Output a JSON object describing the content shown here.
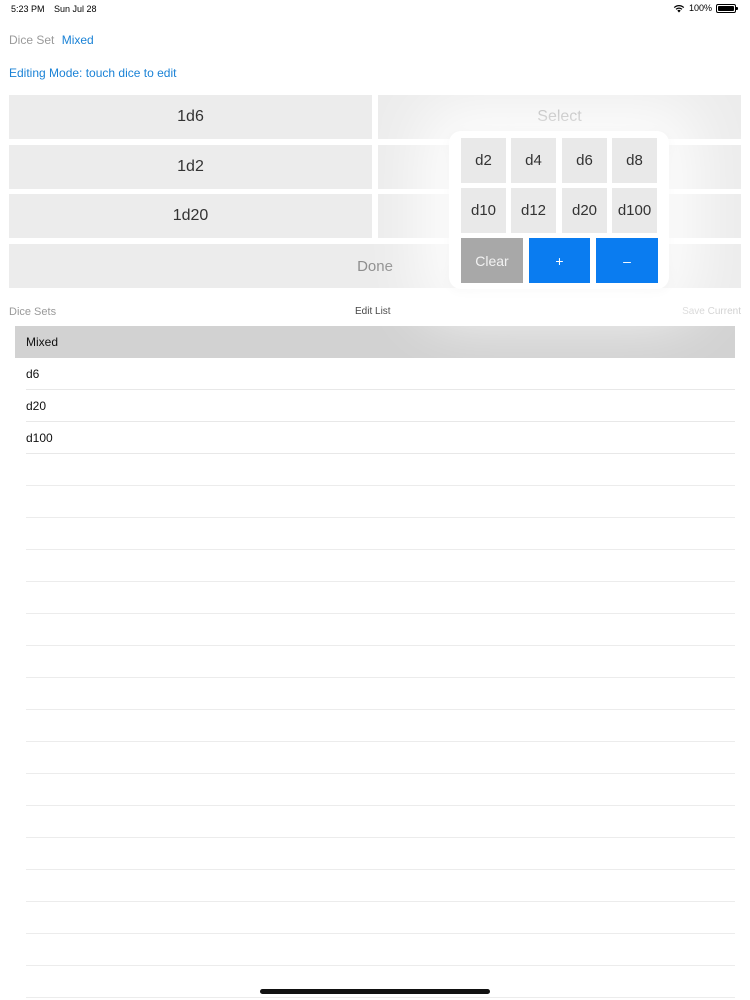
{
  "status_bar": {
    "time": "5:23 PM",
    "date": "Sun Jul 28",
    "battery": "100%"
  },
  "header": {
    "dice_set_label": "Dice Set",
    "dice_set_value": "Mixed",
    "editing_mode": "Editing Mode: touch dice to edit"
  },
  "dice_grid": {
    "left": [
      "1d6",
      "1d2",
      "1d20"
    ],
    "select": "Select",
    "done": "Done"
  },
  "list_header": {
    "dice_sets": "Dice Sets",
    "edit_list": "Edit List",
    "save_current": "Save Current"
  },
  "dice_sets": [
    {
      "label": "Mixed",
      "selected": true
    },
    {
      "label": "d6",
      "selected": false
    },
    {
      "label": "d20",
      "selected": false
    },
    {
      "label": "d100",
      "selected": false
    }
  ],
  "popover": {
    "dice_row1": [
      "d2",
      "d4",
      "d6",
      "d8"
    ],
    "dice_row2": [
      "d10",
      "d12",
      "d20",
      "d100"
    ],
    "clear": "Clear",
    "plus": "+",
    "minus": "–"
  },
  "colors": {
    "accent_blue": "#1a82d6",
    "key_blue": "#0a7cf0",
    "clear_gray": "#a8a8a8",
    "button_gray": "#ececec"
  }
}
